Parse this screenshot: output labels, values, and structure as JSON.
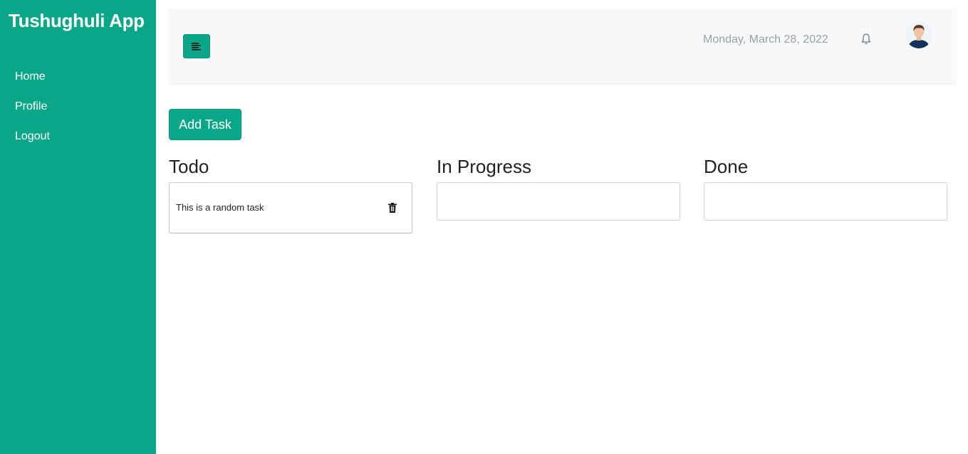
{
  "sidebar": {
    "title": "Tushughuli App",
    "items": [
      {
        "label": "Home"
      },
      {
        "label": "Profile"
      },
      {
        "label": "Logout"
      }
    ]
  },
  "topbar": {
    "menu_icon": "align-left-icon",
    "date": "Monday, March 28, 2022",
    "bell_icon": "bell-icon",
    "avatar_icon": "user-avatar"
  },
  "actions": {
    "add_task_label": "Add Task"
  },
  "board": {
    "columns": [
      {
        "title": "Todo",
        "tasks": [
          {
            "text": "This is a random task",
            "icon": "trash-icon"
          }
        ]
      },
      {
        "title": "In Progress",
        "tasks": []
      },
      {
        "title": "Done",
        "tasks": []
      }
    ]
  },
  "colors": {
    "accent": "#0aa688",
    "topbar_bg": "#f7f8fa",
    "text_dark": "#1f2124",
    "text_muted": "#9a9ea6"
  }
}
